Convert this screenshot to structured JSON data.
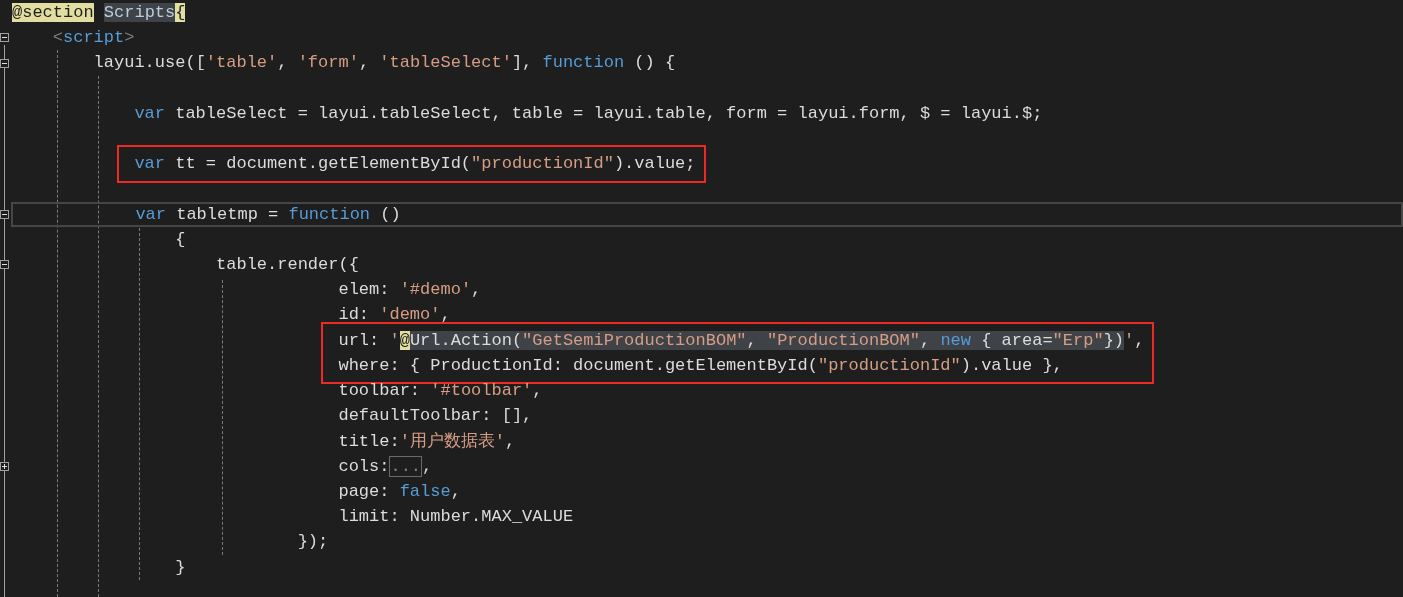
{
  "editor": {
    "blocks": [
      {
        "boxed": false,
        "lines": [
          {
            "kind": "code",
            "current": false,
            "tokens": [
              {
                "kind": "razor",
                "text": "@section",
                "selected": false
              },
              {
                "kind": "identifier",
                "text": "Scripts",
                "selected": true,
                "space_before": true
              },
              {
                "kind": "razor",
                "text": "{",
                "selected": false
              }
            ]
          },
          {
            "kind": "code",
            "expanded": true,
            "current": false,
            "tokens": [
              {
                "kind": "punct",
                "text": "<",
                "selected": false
              },
              {
                "kind": "keyword",
                "text": "script",
                "selected": false
              },
              {
                "kind": "punct",
                "text": ">",
                "selected": false
              }
            ]
          },
          {
            "kind": "code",
            "expanded": true,
            "current": false,
            "tokens": [
              {
                "kind": "plain",
                "text": "layui.use([",
                "selected": false
              },
              {
                "kind": "string",
                "text": "'table'",
                "selected": false
              },
              {
                "kind": "plain",
                "text": ",",
                "selected": false
              },
              {
                "kind": "string",
                "text": "'form'",
                "selected": false,
                "space_before": true
              },
              {
                "kind": "plain",
                "text": ",",
                "selected": false
              },
              {
                "kind": "string",
                "text": "'tableSelect'",
                "selected": false,
                "space_before": true
              },
              {
                "kind": "plain",
                "text": "],",
                "selected": false
              },
              {
                "kind": "keyword",
                "text": "function",
                "selected": false,
                "space_before": true
              },
              {
                "kind": "plain",
                "text": "() {",
                "selected": false,
                "space_before": true
              }
            ]
          },
          {
            "kind": "blank"
          },
          {
            "kind": "code",
            "current": false,
            "tokens": [
              {
                "kind": "keyword",
                "text": "var",
                "selected": false
              },
              {
                "kind": "plain",
                "text": "tableSelect = layui.tableSelect, table = layui.table, form = layui.form, $ = layui.$;",
                "selected": false,
                "space_before": true
              }
            ]
          },
          {
            "kind": "blank"
          }
        ]
      },
      {
        "boxed": true,
        "lines": [
          {
            "kind": "code",
            "current": false,
            "tokens": [
              {
                "kind": "keyword",
                "text": "var",
                "selected": false
              },
              {
                "kind": "plain",
                "text": "tt = document.getElementById(",
                "selected": false,
                "space_before": true
              },
              {
                "kind": "string",
                "text": "\"productionId\"",
                "selected": false
              },
              {
                "kind": "plain",
                "text": ").value;",
                "selected": false
              }
            ]
          }
        ]
      },
      {
        "boxed": false,
        "lines": [
          {
            "kind": "blank"
          },
          {
            "kind": "code",
            "expanded": true,
            "current": true,
            "tokens": [
              {
                "kind": "keyword",
                "text": "var",
                "selected": false
              },
              {
                "kind": "plain",
                "text": "tabletmp =",
                "selected": false,
                "space_before": true
              },
              {
                "kind": "keyword",
                "text": "function",
                "selected": false,
                "space_before": true
              },
              {
                "kind": "plain",
                "text": "()",
                "selected": false,
                "space_before": true
              }
            ]
          },
          {
            "kind": "code",
            "current": false,
            "tokens": [
              {
                "kind": "plain",
                "text": "{",
                "selected": false
              }
            ]
          },
          {
            "kind": "code",
            "expanded": true,
            "current": false,
            "tokens": [
              {
                "kind": "plain",
                "text": "table.render({",
                "selected": false
              }
            ]
          },
          {
            "kind": "code",
            "current": false,
            "tokens": [
              {
                "kind": "plain",
                "text": "elem:",
                "selected": false
              },
              {
                "kind": "string",
                "text": "'#demo'",
                "selected": false,
                "space_before": true
              },
              {
                "kind": "plain",
                "text": ",",
                "selected": false
              }
            ]
          },
          {
            "kind": "code",
            "current": false,
            "tokens": [
              {
                "kind": "plain",
                "text": "id:",
                "selected": false
              },
              {
                "kind": "string",
                "text": "'demo'",
                "selected": false,
                "space_before": true
              },
              {
                "kind": "plain",
                "text": ",",
                "selected": false
              }
            ]
          }
        ]
      },
      {
        "boxed": true,
        "lines": [
          {
            "kind": "code",
            "current": false,
            "tokens": [
              {
                "kind": "plain",
                "text": "url:",
                "selected": false
              },
              {
                "kind": "string",
                "text": "'",
                "selected": false,
                "space_before": true
              },
              {
                "kind": "razor",
                "text": "@",
                "selected": false
              },
              {
                "kind": "plain",
                "text": "Url.Action(",
                "selected": true
              },
              {
                "kind": "string",
                "text": "\"GetSemiProductionBOM\"",
                "selected": true
              },
              {
                "kind": "plain",
                "text": ", ",
                "selected": true
              },
              {
                "kind": "string",
                "text": "\"ProductionBOM\"",
                "selected": true
              },
              {
                "kind": "plain",
                "text": ", ",
                "selected": true
              },
              {
                "kind": "keyword",
                "text": "new",
                "selected": true
              },
              {
                "kind": "plain",
                "text": " { area=",
                "selected": true
              },
              {
                "kind": "string",
                "text": "\"Erp\"",
                "selected": true
              },
              {
                "kind": "plain",
                "text": "})",
                "selected": true
              },
              {
                "kind": "string",
                "text": "'",
                "selected": false
              },
              {
                "kind": "plain",
                "text": ",",
                "selected": false
              }
            ]
          },
          {
            "kind": "code",
            "current": false,
            "tokens": [
              {
                "kind": "plain",
                "text": "where: { ProductionId: document.getElementById(",
                "selected": false
              },
              {
                "kind": "string",
                "text": "\"productionId\"",
                "selected": false
              },
              {
                "kind": "plain",
                "text": ").value },",
                "selected": false
              }
            ]
          }
        ]
      },
      {
        "boxed": false,
        "lines": [
          {
            "kind": "code",
            "current": false,
            "tokens": [
              {
                "kind": "plain",
                "text": "toolbar:",
                "selected": false
              },
              {
                "kind": "string",
                "text": "'#toolbar'",
                "selected": false,
                "space_before": true
              },
              {
                "kind": "plain",
                "text": ",",
                "selected": false
              }
            ]
          },
          {
            "kind": "code",
            "current": false,
            "tokens": [
              {
                "kind": "plain",
                "text": "defaultToolbar: [],",
                "selected": false
              }
            ]
          },
          {
            "kind": "code",
            "current": false,
            "tokens": [
              {
                "kind": "plain",
                "text": "title:",
                "selected": false
              },
              {
                "kind": "string",
                "text": "'用户数据表'",
                "selected": false
              },
              {
                "kind": "plain",
                "text": ",",
                "selected": false
              }
            ]
          },
          {
            "kind": "code",
            "expanded": false,
            "current": false,
            "tokens": [
              {
                "kind": "plain",
                "text": "cols:",
                "selected": false
              },
              {
                "kind": "collapsed",
                "text": "...",
                "selected": false
              },
              {
                "kind": "plain",
                "text": ",",
                "selected": false
              }
            ]
          },
          {
            "kind": "code",
            "current": false,
            "tokens": [
              {
                "kind": "plain",
                "text": "page:",
                "selected": false
              },
              {
                "kind": "keyword",
                "text": "false",
                "selected": false,
                "space_before": true
              },
              {
                "kind": "plain",
                "text": ",",
                "selected": false
              }
            ]
          },
          {
            "kind": "code",
            "current": false,
            "tokens": [
              {
                "kind": "plain",
                "text": "limit: Number.MAX_VALUE",
                "selected": false
              }
            ]
          },
          {
            "kind": "code",
            "current": false,
            "tokens": [
              {
                "kind": "plain",
                "text": "});",
                "selected": false
              }
            ]
          },
          {
            "kind": "code",
            "current": false,
            "tokens": [
              {
                "kind": "plain",
                "text": "}",
                "selected": false
              }
            ]
          }
        ]
      }
    ]
  }
}
